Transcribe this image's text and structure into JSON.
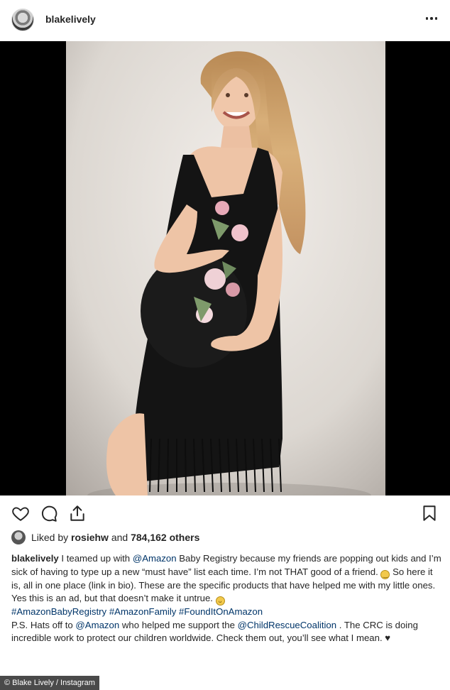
{
  "post": {
    "username": "blakelively",
    "more_icon": "more-horizontal-icon",
    "image_alt": "Pregnant woman in black floral fringe dress"
  },
  "actions": {
    "like_icon": "heart-icon",
    "comment_icon": "comment-icon",
    "share_icon": "share-icon",
    "save_icon": "bookmark-icon"
  },
  "likes": {
    "prefix": "Liked by ",
    "user": "rosiehw",
    "middle": " and ",
    "count": "784,162 others"
  },
  "caption": {
    "user": "blakelively",
    "part1": " I teamed up with ",
    "mention1": "@Amazon",
    "part2": " Baby Registry because my friends are popping out kids and I’m sick of having to type up a new “must have” list each time. I’m not THAT good of a friend. ",
    "part3": " So here it is, all in one place (link in bio). These are the specific products that have helped me with my little ones. Yes this is an ad, but that doesn’t make it untrue. ",
    "hashtag1": "#AmazonBabyRegistry",
    "hashtag2": "#AmazonFamily",
    "hashtag3": "#FoundItOnAmazon",
    "part4": "P.S. Hats off to ",
    "mention2": "@Amazon",
    "part5": " who helped me support the ",
    "mention3": "@ChildRescueCoalition",
    "part6": " . The CRC is doing incredible work to protect our children worldwide. Check them out, you’ll see what I mean. ♥"
  },
  "credit": "© Blake Lively / Instagram",
  "colors": {
    "link": "#003569",
    "text": "#262626",
    "media_bg": "#000000"
  }
}
